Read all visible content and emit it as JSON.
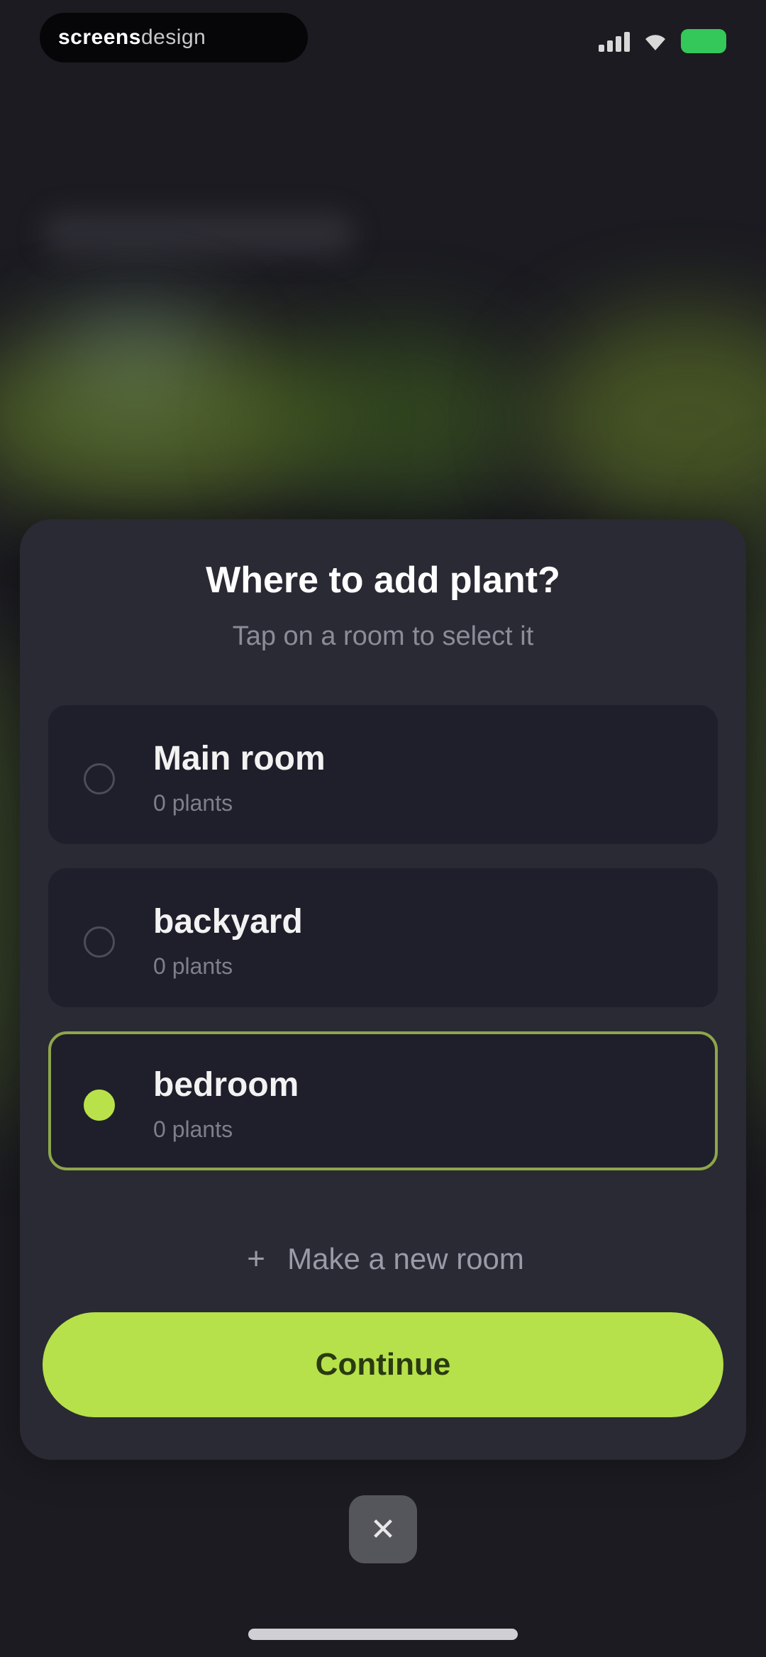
{
  "status_bar": {
    "brand_strong": "screens",
    "brand_light": "design",
    "icons": [
      "signal-icon",
      "wifi-icon",
      "battery-icon"
    ],
    "battery_color": "#34c759"
  },
  "sheet": {
    "title": "Where to add plant?",
    "subtitle": "Tap on a room to select it",
    "rooms": [
      {
        "name": "Main room",
        "count": "0 plants",
        "selected": false
      },
      {
        "name": "backyard",
        "count": "0 plants",
        "selected": false
      },
      {
        "name": "bedroom",
        "count": "0 plants",
        "selected": true
      }
    ],
    "new_room_label": "Make a new room",
    "continue_label": "Continue"
  },
  "close": {
    "label": "✕"
  },
  "colors": {
    "accent": "#b6e14a",
    "selected_border": "#8ea64a",
    "sheet_bg": "#2a2a34",
    "card_bg": "#1f1f2b"
  }
}
